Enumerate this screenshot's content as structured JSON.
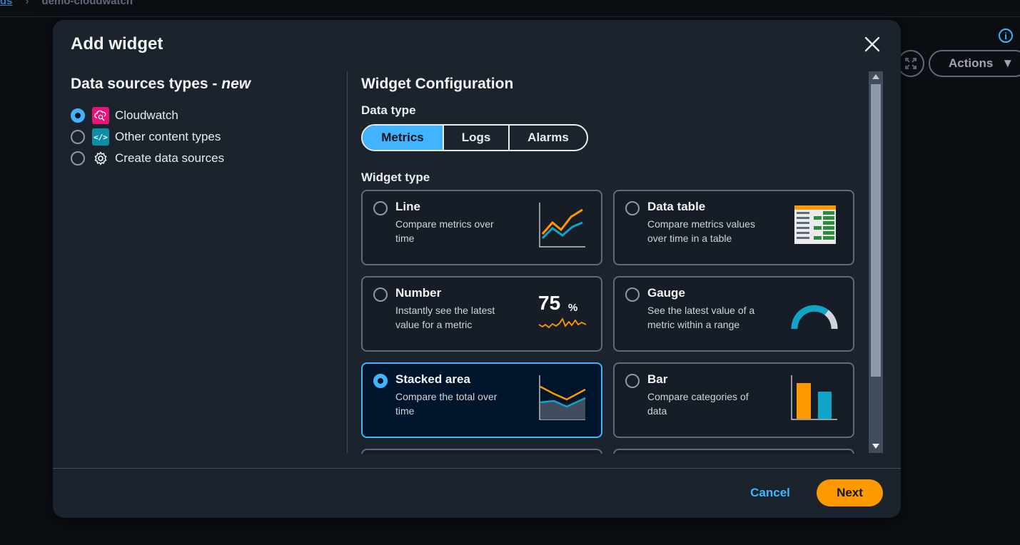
{
  "background": {
    "breadcrumb_link": "ds",
    "breadcrumb_current": "demo-cloudwatch",
    "actions_label": "Actions"
  },
  "modal": {
    "title": "Add widget",
    "left": {
      "heading": "Data sources types - ",
      "heading_emphasis": "new",
      "sources": [
        {
          "label": "Cloudwatch",
          "icon": "cloudwatch-icon",
          "selected": true
        },
        {
          "label": "Other content types",
          "icon": "code-icon",
          "selected": false
        },
        {
          "label": "Create data sources",
          "icon": "gear-icon",
          "selected": false
        }
      ]
    },
    "right": {
      "heading": "Widget Configuration",
      "data_type_label": "Data type",
      "data_types": [
        "Metrics",
        "Logs",
        "Alarms"
      ],
      "active_data_type": "Metrics",
      "widget_type_label": "Widget type",
      "widgets": [
        {
          "title": "Line",
          "desc": "Compare metrics over time",
          "icon": "line-chart-icon",
          "selected": false
        },
        {
          "title": "Data table",
          "desc": "Compare metrics values over time in a table",
          "icon": "data-table-icon",
          "selected": false
        },
        {
          "title": "Number",
          "desc": "Instantly see the latest value for a metric",
          "icon": "number-icon",
          "selected": false,
          "graphic_number": "75",
          "graphic_unit": "%"
        },
        {
          "title": "Gauge",
          "desc": "See the latest value of a metric within a range",
          "icon": "gauge-icon",
          "selected": false
        },
        {
          "title": "Stacked area",
          "desc": "Compare the total over time",
          "icon": "stacked-area-icon",
          "selected": true
        },
        {
          "title": "Bar",
          "desc": "Compare categories of data",
          "icon": "bar-chart-icon",
          "selected": false
        }
      ]
    },
    "footer": {
      "cancel_label": "Cancel",
      "next_label": "Next"
    }
  },
  "colors": {
    "accent": "#42b4ff",
    "primary_button": "#ff9900",
    "chart_orange": "#ff9900",
    "chart_teal": "#0ea5c9"
  }
}
